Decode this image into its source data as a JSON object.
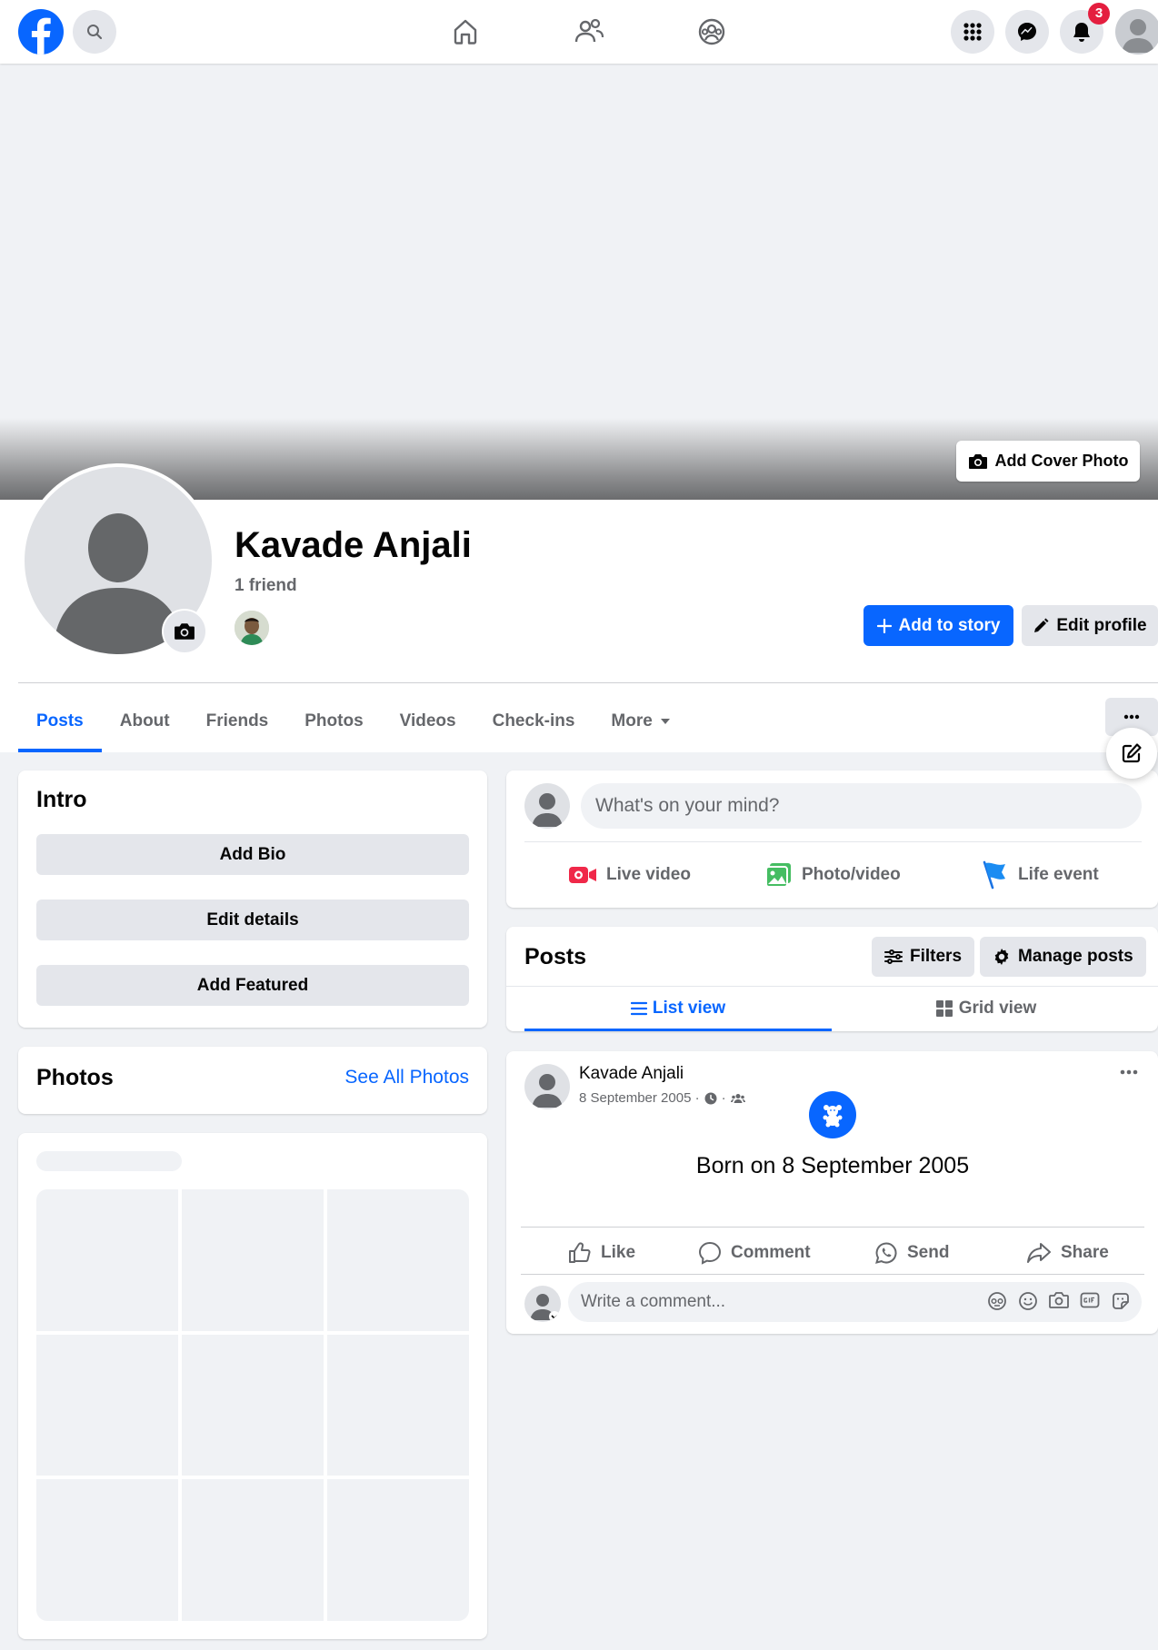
{
  "topbar": {
    "notifications_count": "3",
    "icons": [
      "facebook-logo",
      "search-icon",
      "home-icon",
      "friends-icon",
      "groups-icon",
      "menu-grid-icon",
      "messenger-icon",
      "bell-icon",
      "avatar"
    ]
  },
  "cover": {
    "add_cover_label": "Add Cover Photo"
  },
  "profile": {
    "name": "Kavade Anjali",
    "friend_count": "1 friend",
    "add_story_label": "Add to story",
    "edit_profile_label": "Edit profile"
  },
  "tabs": [
    {
      "label": "Posts",
      "active": true
    },
    {
      "label": "About"
    },
    {
      "label": "Friends"
    },
    {
      "label": "Photos"
    },
    {
      "label": "Videos"
    },
    {
      "label": "Check-ins"
    },
    {
      "label": "More"
    }
  ],
  "intro": {
    "title": "Intro",
    "buttons": [
      "Add Bio",
      "Edit details",
      "Add Featured"
    ]
  },
  "photos": {
    "title": "Photos",
    "see_all": "See All Photos"
  },
  "composer": {
    "placeholder": "What's on your mind?",
    "actions": [
      "Live video",
      "Photo/video",
      "Life event"
    ]
  },
  "posts_section": {
    "title": "Posts",
    "filters_label": "Filters",
    "manage_label": "Manage posts",
    "views": [
      "List view",
      "Grid view"
    ]
  },
  "post": {
    "author": "Kavade Anjali",
    "date": "8 September 2005 ·",
    "content": "Born on 8 September 2005",
    "actions": [
      "Like",
      "Comment",
      "Send",
      "Share"
    ],
    "comment_placeholder": "Write a comment..."
  },
  "colors": {
    "brand": "#0866ff",
    "background": "#f0f2f5",
    "button_gray": "#e4e6eb",
    "text_secondary": "#65676b",
    "badge": "#e41e3f"
  }
}
